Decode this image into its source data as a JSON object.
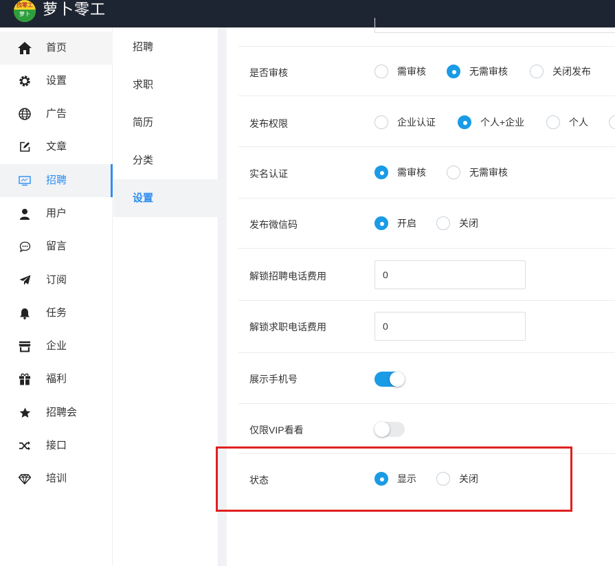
{
  "app": {
    "logo_text_top": "找零工",
    "logo_text_bottom": "萝卜",
    "title": "萝卜零工"
  },
  "sidebar": {
    "items": [
      {
        "label": "首页",
        "icon": "home-icon"
      },
      {
        "label": "设置",
        "icon": "gear-icon"
      },
      {
        "label": "广告",
        "icon": "globe-icon"
      },
      {
        "label": "文章",
        "icon": "edit-icon"
      },
      {
        "label": "招聘",
        "icon": "monitor-icon"
      },
      {
        "label": "用户",
        "icon": "user-icon"
      },
      {
        "label": "留言",
        "icon": "chat-bubble-icon"
      },
      {
        "label": "订阅",
        "icon": "paper-plane-icon"
      },
      {
        "label": "任务",
        "icon": "bell-icon"
      },
      {
        "label": "企业",
        "icon": "store-icon"
      },
      {
        "label": "福利",
        "icon": "gift-icon"
      },
      {
        "label": "招聘会",
        "icon": "star-icon"
      },
      {
        "label": "接口",
        "icon": "shuffle-icon"
      },
      {
        "label": "培训",
        "icon": "diamond-icon"
      }
    ],
    "active": "招聘"
  },
  "subnav": {
    "items": [
      {
        "label": "招聘"
      },
      {
        "label": "求职"
      },
      {
        "label": "简历"
      },
      {
        "label": "分类"
      },
      {
        "label": "设置"
      }
    ],
    "active": "设置"
  },
  "settings": {
    "review": {
      "label": "是否审核",
      "options": [
        "需审核",
        "无需审核",
        "关闭发布"
      ],
      "selected": "无需审核"
    },
    "publish_permission": {
      "label": "发布权限",
      "options": [
        "企业认证",
        "个人+企业",
        "个人"
      ],
      "selected": "个人+企业"
    },
    "real_name": {
      "label": "实名认证",
      "options": [
        "需审核",
        "无需审核"
      ],
      "selected": "需审核"
    },
    "wechat_code": {
      "label": "发布微信码",
      "options": [
        "开启",
        "关闭"
      ],
      "selected": "开启"
    },
    "unlock_job_phone_fee": {
      "label": "解锁招聘电话费用",
      "value": "0"
    },
    "unlock_seeker_phone_fee": {
      "label": "解锁求职电话费用",
      "value": "0"
    },
    "show_phone": {
      "label": "展示手机号",
      "enabled": true
    },
    "vip_only": {
      "label": "仅限VIP看看",
      "enabled": false
    },
    "status": {
      "label": "状态",
      "options": [
        "显示",
        "关闭"
      ],
      "selected": "显示"
    }
  },
  "colors": {
    "topbar": "#1e2532",
    "accent": "#2d8cf0",
    "radio_checked": "#1a9be6",
    "highlight": "#e02020"
  }
}
